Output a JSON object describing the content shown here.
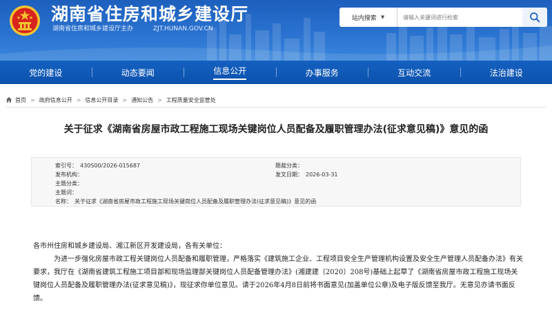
{
  "header": {
    "title": "湖南省住房和城乡建设厅",
    "sponsor": "湖南省住房和城乡建设厅主办",
    "domain": "ZJT.HUNAN.GOV.CN",
    "search": {
      "scope": "站内搜索",
      "placeholder": "请输入关键词进行检索"
    }
  },
  "nav": {
    "items": [
      {
        "label": "党的建设"
      },
      {
        "label": "动态要闻"
      },
      {
        "label": "信息公开"
      },
      {
        "label": "办事服务"
      },
      {
        "label": "互动交流"
      },
      {
        "label": "法治建设"
      }
    ],
    "active_index": 2
  },
  "breadcrumb": {
    "items": [
      "首页",
      "政府信息公开",
      "信息公开目录",
      "通知公告",
      "工程质量安全监管处"
    ]
  },
  "article": {
    "title": "关于征求《湖南省房屋市政工程施工现场关键岗位人员配备及履职管理办法(征求意见稿)》意见的函",
    "meta": {
      "index_label": "索引号：",
      "index_value": "430S00/2026-015687",
      "category_label": "题裁分类：",
      "category_value": "",
      "issuer_label": "发布机构：",
      "issuer_value": "",
      "date_label": "发文日期：",
      "date_value": "2026-03-31",
      "theme_label": "主题分类：",
      "theme_value": "",
      "keyword_label": "主题词：",
      "keyword_value": "",
      "name_label": "名称：",
      "name_value": "关于征求《湖南省房屋市政工程施工现场关键岗位人员配备及履职管理办法(征求意见稿)》意见的函"
    },
    "salutation": "各市州住房和城乡建设局、湘江新区开发建设局，各有关单位：",
    "paragraph": "为进一步强化房屋市政工程关键岗位人员配备和履职管理，严格落实《建筑施工企业、工程项目安全生产管理机构设置及安全生产管理人员配备办法》有关要求，我厅在《湖南省建筑工程施工项目部和现场监理部关键岗位人员配备管理办法》(湘建建〔2020〕208号)基础上起草了《湖南省房屋市政工程施工现场关键岗位人员配备及履职管理办法(征求意见稿)》，现征求你单位意见。请于2026年4月8日前将书面意见(加盖单位公章)及电子版反馈至我厅。无意见亦请书面反馈。"
  },
  "colors": {
    "header_blue": "#2a72cf",
    "nav_blue": "#0c52ad",
    "emblem_red": "#d8241c",
    "emblem_gold": "#f4c430"
  }
}
